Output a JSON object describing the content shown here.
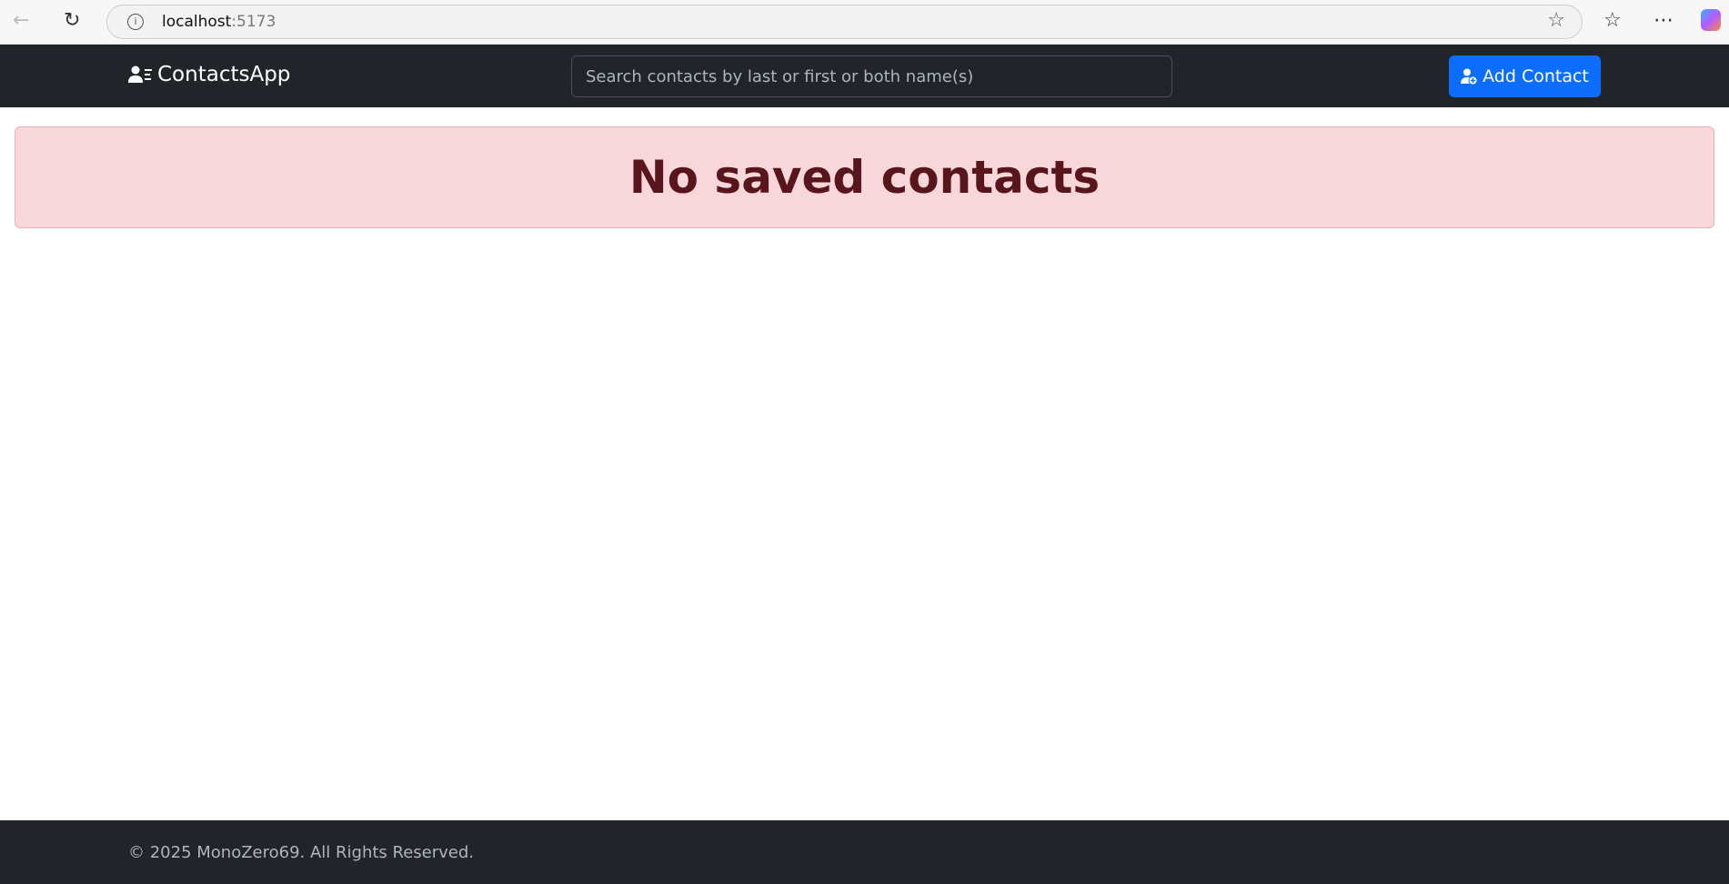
{
  "browser": {
    "host": "localhost",
    "port": ":5173",
    "back_icon": "arrow-left-icon",
    "reload_icon": "reload-icon"
  },
  "navbar": {
    "brand": "ContactsApp",
    "search_placeholder": "Search contacts by last or first or both name(s)",
    "add_label": "Add Contact"
  },
  "main": {
    "alert": "No saved contacts"
  },
  "footer": {
    "text": "© 2025 MonoZero69. All Rights Reserved."
  },
  "colors": {
    "navbar": "#212529",
    "primary": "#0d6efd",
    "alert_bg": "#f8d7da",
    "alert_text": "#58151c"
  }
}
